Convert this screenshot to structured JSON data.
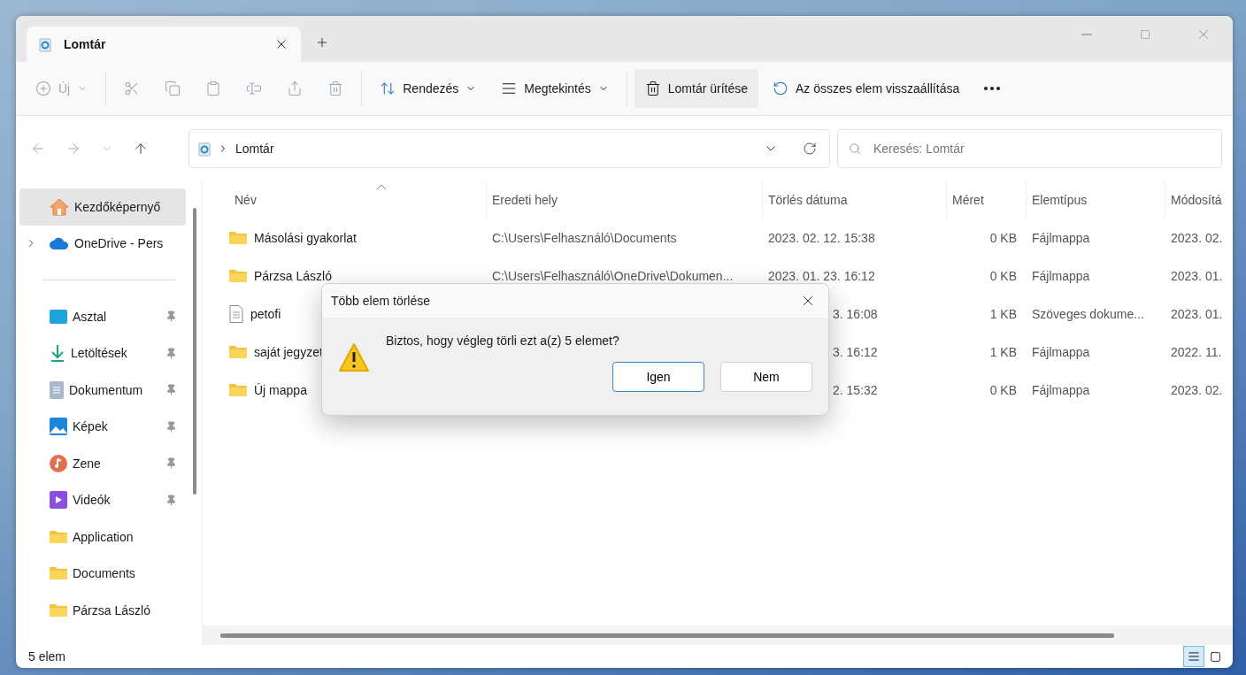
{
  "tabs": [
    {
      "label": "Lomtár",
      "selected": true
    }
  ],
  "toolbar": [
    {
      "kind": "new",
      "label": "Új",
      "disabled": true
    },
    {
      "kind": "cut",
      "disabled": true
    },
    {
      "kind": "copy",
      "disabled": true
    },
    {
      "kind": "paste",
      "disabled": true
    },
    {
      "kind": "rename",
      "disabled": true
    },
    {
      "kind": "share",
      "disabled": true
    },
    {
      "kind": "delete",
      "disabled": true
    },
    {
      "kind": "sort",
      "label": "Rendezés",
      "disabled": false
    },
    {
      "kind": "view",
      "label": "Megtekintés",
      "disabled": false
    },
    {
      "kind": "empty",
      "label": "Lomtár ürítése",
      "disabled": false,
      "selected": true
    },
    {
      "kind": "restore",
      "label": "Az összes elem visszaállítása",
      "disabled": false,
      "selected": false
    }
  ],
  "address": {
    "path": "Lomtár"
  },
  "search": {
    "placeholder": "Keresés: Lomtár"
  },
  "sidebar": [
    {
      "kind": "home",
      "label": "Kezdőképernyő",
      "selected": true,
      "pinned": false,
      "expandable": false
    },
    {
      "kind": "cloud",
      "label": "OneDrive - Pers",
      "selected": false,
      "pinned": false,
      "expandable": true
    },
    {
      "kind": "divider"
    },
    {
      "kind": "desktop",
      "label": "Asztal",
      "selected": false,
      "pinned": true,
      "expandable": false
    },
    {
      "kind": "download",
      "label": "Letöltések",
      "selected": false,
      "pinned": true,
      "expandable": false
    },
    {
      "kind": "document",
      "label": "Dokumentum",
      "selected": false,
      "pinned": true,
      "expandable": false
    },
    {
      "kind": "pictures",
      "label": "Képek",
      "selected": false,
      "pinned": true,
      "expandable": false
    },
    {
      "kind": "music",
      "label": "Zene",
      "selected": false,
      "pinned": true,
      "expandable": false
    },
    {
      "kind": "videos",
      "label": "Videók",
      "selected": false,
      "pinned": true,
      "expandable": false
    },
    {
      "kind": "folder",
      "label": "Application",
      "selected": false,
      "pinned": false,
      "expandable": false
    },
    {
      "kind": "folder",
      "label": "Documents",
      "selected": false,
      "pinned": false,
      "expandable": false
    },
    {
      "kind": "folder",
      "label": "Párzsa László",
      "selected": false,
      "pinned": false,
      "expandable": false
    }
  ],
  "table": {
    "columns": [
      "Név",
      "Eredeti hely",
      "Törlés dátuma",
      "Méret",
      "Elemtípus",
      "Módosítá"
    ],
    "rows": [
      {
        "kind": "folder",
        "name": "Másolási gyakorlat",
        "location": "C:\\Users\\Felhasználó\\Documents",
        "deleted": "2023. 02. 12. 15:38",
        "size": "0 KB",
        "type": "Fájlmappa",
        "modified": "2023. 02."
      },
      {
        "kind": "folder",
        "name": "Párzsa László",
        "location": "C:\\Users\\Felhasználó\\OneDrive\\Dokumen...",
        "deleted": "2023. 01. 23. 16:12",
        "size": "0 KB",
        "type": "Fájlmappa",
        "modified": "2023. 01."
      },
      {
        "kind": "text",
        "name": "petofi",
        "deleted": "3. 16:08",
        "size": "1 KB",
        "type": "Szöveges dokume...",
        "modified": "2023. 01."
      },
      {
        "kind": "folder",
        "name": "saját jegyzet",
        "deleted": "3. 16:12",
        "size": "1 KB",
        "type": "Fájlmappa",
        "modified": "2022. 11."
      },
      {
        "kind": "folder",
        "name": "Új mappa",
        "deleted": "2. 15:32",
        "size": "0 KB",
        "type": "Fájlmappa",
        "modified": "2023. 02."
      }
    ]
  },
  "dialog": {
    "title": "Több elem törlése",
    "message": "Biztos, hogy végleg törli ezt a(z) 5 elemet?",
    "buttons": [
      {
        "label": "Igen",
        "selected": true
      },
      {
        "label": "Nem",
        "selected": false
      }
    ]
  },
  "status_bar": {
    "text": "5 elem",
    "views": [
      {
        "kind": "details",
        "selected": true
      },
      {
        "kind": "tiles",
        "selected": false
      }
    ]
  }
}
